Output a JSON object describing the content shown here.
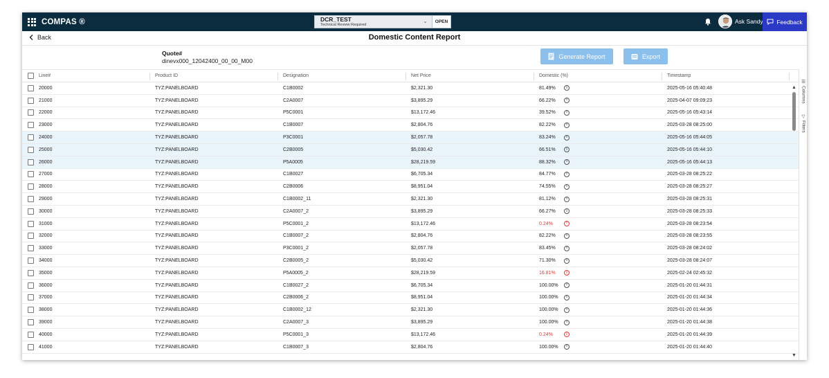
{
  "app": {
    "brand": "COMPAS ®",
    "quote_name": "DCR_TEST",
    "quote_status": "Technical Review Required",
    "quote_state": "OPEN",
    "user_name": "Ask Sandy",
    "feedback_label": "Feedback"
  },
  "subheader": {
    "back_label": "Back",
    "title": "Domestic Content Report"
  },
  "quote": {
    "label": "Quote#",
    "value": "dinevx000_12042400_00_00_M00"
  },
  "actions": {
    "generate_label": "Generate Report",
    "export_label": "Export"
  },
  "table": {
    "columns": [
      "Line#",
      "Product ID",
      "Designation",
      "Net Price",
      "Domestic (%)",
      "Timestamp"
    ],
    "rows": [
      {
        "line": "20000",
        "product": "TYZ:PANELBOARD",
        "designation": "C1B0002",
        "price": "$2,321.30",
        "domestic": "81.49%",
        "timestamp": "2025-05-16 05:40:48",
        "low": false,
        "selected": false
      },
      {
        "line": "21000",
        "product": "TYZ:PANELBOARD",
        "designation": "C2A0007",
        "price": "$3,895.29",
        "domestic": "66.22%",
        "timestamp": "2025-04-07 09:09:23",
        "low": false,
        "selected": false
      },
      {
        "line": "22000",
        "product": "TYZ:PANELBOARD",
        "designation": "P5C0001",
        "price": "$13,172.46",
        "domestic": "39.52%",
        "timestamp": "2025-05-16 05:43:14",
        "low": false,
        "selected": false
      },
      {
        "line": "23000",
        "product": "TYZ:PANELBOARD",
        "designation": "C1B0007",
        "price": "$2,804.76",
        "domestic": "82.22%",
        "timestamp": "2025-03-28 08:25:00",
        "low": false,
        "selected": false
      },
      {
        "line": "24000",
        "product": "TYZ:PANELBOARD",
        "designation": "P3C0001",
        "price": "$2,057.78",
        "domestic": "83.24%",
        "timestamp": "2025-05-16 05:44:05",
        "low": false,
        "selected": true
      },
      {
        "line": "25000",
        "product": "TYZ:PANELBOARD",
        "designation": "C2B0005",
        "price": "$5,030.42",
        "domestic": "66.51%",
        "timestamp": "2025-05-16 05:44:10",
        "low": false,
        "selected": true
      },
      {
        "line": "26000",
        "product": "TYZ:PANELBOARD",
        "designation": "P5A0005",
        "price": "$28,219.59",
        "domestic": "88.32%",
        "timestamp": "2025-05-16 05:44:13",
        "low": false,
        "selected": true
      },
      {
        "line": "27000",
        "product": "TYZ:PANELBOARD",
        "designation": "C1B0027",
        "price": "$6,705.34",
        "domestic": "84.77%",
        "timestamp": "2025-03-28 08:25:22",
        "low": false,
        "selected": false
      },
      {
        "line": "28000",
        "product": "TYZ:PANELBOARD",
        "designation": "C2B0006",
        "price": "$8,951.04",
        "domestic": "74.55%",
        "timestamp": "2025-03-28 08:25:27",
        "low": false,
        "selected": false
      },
      {
        "line": "29000",
        "product": "TYZ:PANELBOARD",
        "designation": "C1B0002_11",
        "price": "$2,321.30",
        "domestic": "81.12%",
        "timestamp": "2025-03-28 08:25:31",
        "low": false,
        "selected": false
      },
      {
        "line": "30000",
        "product": "TYZ:PANELBOARD",
        "designation": "C2A0007_2",
        "price": "$3,895.29",
        "domestic": "66.27%",
        "timestamp": "2025-03-28 08:25:33",
        "low": false,
        "selected": false
      },
      {
        "line": "31000",
        "product": "TYZ:PANELBOARD",
        "designation": "P5C0001_2",
        "price": "$13,172.46",
        "domestic": "0.24%",
        "timestamp": "2025-03-28 08:23:54",
        "low": true,
        "selected": false
      },
      {
        "line": "32000",
        "product": "TYZ:PANELBOARD",
        "designation": "C1B0007_2",
        "price": "$2,804.76",
        "domestic": "82.22%",
        "timestamp": "2025-03-28 08:23:55",
        "low": false,
        "selected": false
      },
      {
        "line": "33000",
        "product": "TYZ:PANELBOARD",
        "designation": "P3C0001_2",
        "price": "$2,057.78",
        "domestic": "83.45%",
        "timestamp": "2025-03-28 08:24:02",
        "low": false,
        "selected": false
      },
      {
        "line": "34000",
        "product": "TYZ:PANELBOARD",
        "designation": "C2B0005_2",
        "price": "$5,030.42",
        "domestic": "71.30%",
        "timestamp": "2025-03-28 08:24:07",
        "low": false,
        "selected": false
      },
      {
        "line": "35000",
        "product": "TYZ:PANELBOARD",
        "designation": "P5A0005_2",
        "price": "$28,219.59",
        "domestic": "16.81%",
        "timestamp": "2025-02-24 02:45:32",
        "low": true,
        "selected": false
      },
      {
        "line": "36000",
        "product": "TYZ:PANELBOARD",
        "designation": "C1B0027_2",
        "price": "$6,705.34",
        "domestic": "100.00%",
        "timestamp": "2025-01-20 01:44:31",
        "low": false,
        "selected": false
      },
      {
        "line": "37000",
        "product": "TYZ:PANELBOARD",
        "designation": "C2B0006_2",
        "price": "$8,951.04",
        "domestic": "100.00%",
        "timestamp": "2025-01-20 01:44:34",
        "low": false,
        "selected": false
      },
      {
        "line": "38000",
        "product": "TYZ:PANELBOARD",
        "designation": "C1B0002_12",
        "price": "$2,321.30",
        "domestic": "100.00%",
        "timestamp": "2025-01-20 01:44:36",
        "low": false,
        "selected": false
      },
      {
        "line": "39000",
        "product": "TYZ:PANELBOARD",
        "designation": "C2A0007_3",
        "price": "$3,895.29",
        "domestic": "100.00%",
        "timestamp": "2025-01-20 01:44:38",
        "low": false,
        "selected": false
      },
      {
        "line": "40000",
        "product": "TYZ:PANELBOARD",
        "designation": "P5C0001_3",
        "price": "$13,172.46",
        "domestic": "0.24%",
        "timestamp": "2025-01-20 01:44:39",
        "low": true,
        "selected": false
      },
      {
        "line": "41000",
        "product": "TYZ:PANELBOARD",
        "designation": "C1B0007_3",
        "price": "$2,804.76",
        "domestic": "100.00%",
        "timestamp": "2025-01-20 01:44:40",
        "low": false,
        "selected": false
      }
    ]
  },
  "side_panel": {
    "columns_label": "Columns",
    "filters_label": "Filters"
  },
  "colors": {
    "topbar": "#0b2b3f",
    "feedback": "#2b39c7",
    "button": "#8cc0ec",
    "selected_row": "#eaf5fb",
    "low_value": "#e03a3a"
  },
  "icons": [
    "apps-grid-icon",
    "chevron-down-icon",
    "bell-icon",
    "user-avatar",
    "chat-icon",
    "back-arrow-icon",
    "report-icon",
    "export-icon",
    "info-icon",
    "columns-icon",
    "filter-icon"
  ]
}
